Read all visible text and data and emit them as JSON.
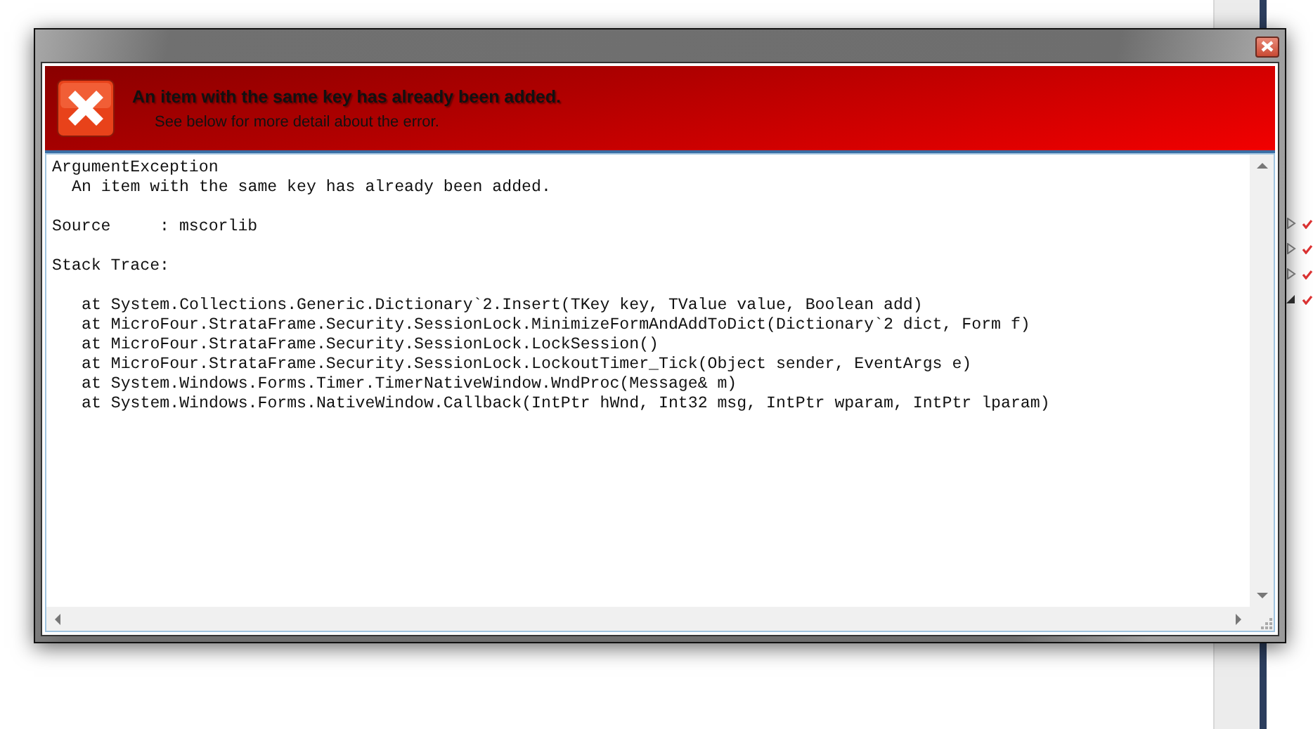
{
  "dialog": {
    "heading": "An item with the same key has already been added.",
    "subheading": "See below for more detail about the error.",
    "details": {
      "exception_type": "ArgumentException",
      "message": "An item with the same key has already been added.",
      "source": "Source     : mscorlib",
      "stack_trace_label": "Stack Trace:",
      "stack_frames": [
        "at System.Collections.Generic.Dictionary`2.Insert(TKey key, TValue value, Boolean add)",
        "at MicroFour.StrataFrame.Security.SessionLock.MinimizeFormAndAddToDict(Dictionary`2 dict, Form f)",
        "at MicroFour.StrataFrame.Security.SessionLock.LockSession()",
        "at MicroFour.StrataFrame.Security.SessionLock.LockoutTimer_Tick(Object sender, EventArgs e)",
        "at System.Windows.Forms.Timer.TimerNativeWindow.WndProc(Message& m)",
        "at System.Windows.Forms.NativeWindow.Callback(IntPtr hWnd, Int32 msg, IntPtr wparam, IntPtr lparam)"
      ]
    }
  },
  "background_tree": [
    {
      "expanded": false
    },
    {
      "expanded": false
    },
    {
      "expanded": false
    },
    {
      "expanded": true
    }
  ]
}
